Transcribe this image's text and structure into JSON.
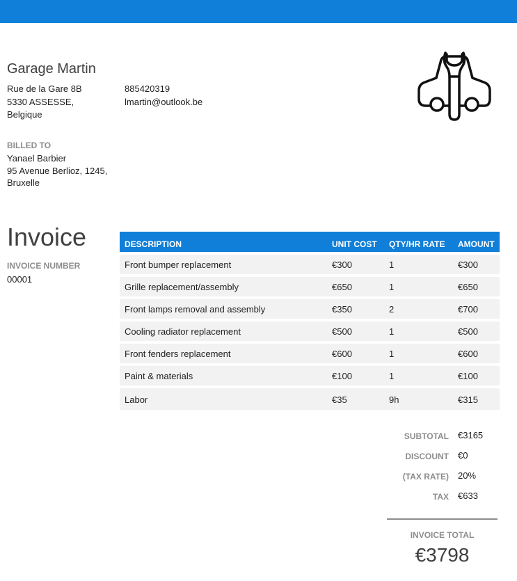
{
  "company": {
    "name": "Garage Martin",
    "address_line1": "Rue de la Gare 8B",
    "address_line2": "5330 ASSESSE,",
    "address_line3": "Belgique",
    "phone": "885420319",
    "email": "lmartin@outlook.be",
    "logo_icon": "car-wrench-icon"
  },
  "billed_to": {
    "label": "BILLED TO",
    "name": "Yanael Barbier",
    "address_line1": "95 Avenue Berlioz, 1245,",
    "address_line2": "Bruxelle"
  },
  "invoice": {
    "title": "Invoice",
    "number_label": "INVOICE NUMBER",
    "number": "00001"
  },
  "table": {
    "headers": [
      "DESCRIPTION",
      "UNIT COST",
      "QTY/HR RATE",
      "AMOUNT"
    ],
    "rows": [
      [
        "Front bumper replacement",
        "€300",
        "1",
        "€300"
      ],
      [
        "Grille replacement/assembly",
        "€650",
        "1",
        "€650"
      ],
      [
        "Front lamps removal and assembly",
        "€350",
        "2",
        "€700"
      ],
      [
        "Cooling radiator replacement",
        "€500",
        "1",
        "€500"
      ],
      [
        "Front fenders replacement",
        "€600",
        "1",
        "€600"
      ],
      [
        "Paint & materials",
        "€100",
        "1",
        "€100"
      ],
      [
        "Labor",
        "€35",
        "9h",
        "€315"
      ]
    ]
  },
  "totals": [
    {
      "label": "SUBTOTAL",
      "value": "€3165"
    },
    {
      "label": "DISCOUNT",
      "value": "€0"
    },
    {
      "label": "(TAX RATE)",
      "value": "20%"
    },
    {
      "label": "TAX",
      "value": "€633"
    }
  ],
  "grand_total": {
    "label": "INVOICE TOTAL",
    "value": "€3798"
  },
  "colors": {
    "accent": "#0f7fd9",
    "row_bg": "#f2f2f2",
    "muted_label": "#8c8c8c"
  }
}
